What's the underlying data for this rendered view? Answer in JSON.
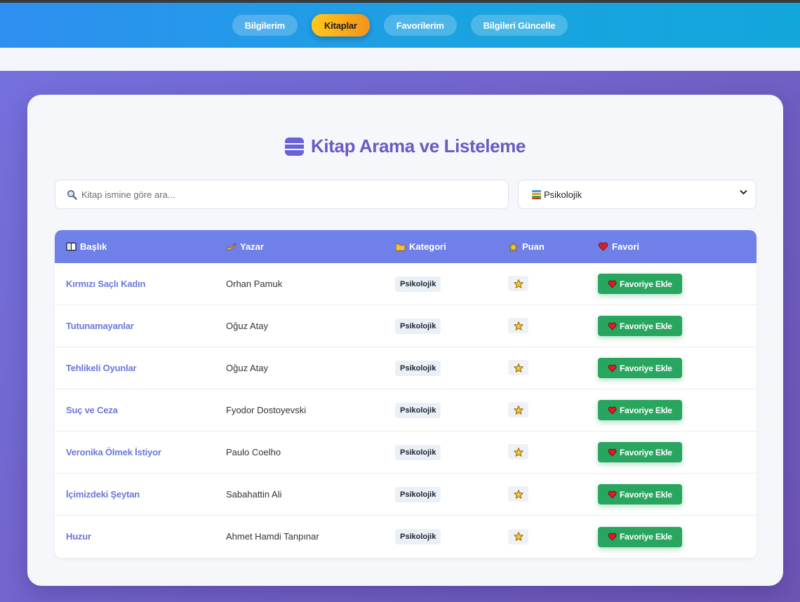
{
  "navbar": {
    "items": [
      {
        "label": "Bilgilerim",
        "active": false
      },
      {
        "label": "Kitaplar",
        "active": true
      },
      {
        "label": "Favorilerim",
        "active": false
      },
      {
        "label": "Bilgileri Güncelle",
        "active": false
      }
    ]
  },
  "page": {
    "title": "Kitap Arama ve Listeleme",
    "title_icon": "books-icon"
  },
  "search": {
    "placeholder": "Kitap ismine göre ara...",
    "value": "",
    "icon": "magnifier-icon"
  },
  "category_select": {
    "selected": "Psikolojik",
    "icon": "books-stack-icon"
  },
  "table": {
    "headers": {
      "title": "Başlık",
      "author": "Yazar",
      "category": "Kategori",
      "rating": "Puan",
      "favorite": "Favori"
    },
    "header_icons": {
      "title": "open-book-icon",
      "author": "writing-hand-icon",
      "category": "folder-icon",
      "rating": "star-icon",
      "favorite": "heart-icon"
    },
    "rows": [
      {
        "title": "Kırmızı Saçlı Kadın",
        "author": "Orhan Pamuk",
        "category": "Psikolojik",
        "button": "Favoriye Ekle"
      },
      {
        "title": "Tutunamayanlar",
        "author": "Oğuz Atay",
        "category": "Psikolojik",
        "button": "Favoriye Ekle"
      },
      {
        "title": "Tehlikeli Oyunlar",
        "author": "Oğuz Atay",
        "category": "Psikolojik",
        "button": "Favoriye Ekle"
      },
      {
        "title": "Suç ve Ceza",
        "author": "Fyodor Dostoyevski",
        "category": "Psikolojik",
        "button": "Favoriye Ekle"
      },
      {
        "title": "Veronika Ölmek İstiyor",
        "author": "Paulo Coelho",
        "category": "Psikolojik",
        "button": "Favoriye Ekle"
      },
      {
        "title": "İçimizdeki Şeytan",
        "author": "Sabahattin Ali",
        "category": "Psikolojik",
        "button": "Favoriye Ekle"
      },
      {
        "title": "Huzur",
        "author": "Ahmet Hamdi Tanpınar",
        "category": "Psikolojik",
        "button": "Favoriye Ekle"
      }
    ]
  },
  "colors": {
    "accent": "#6a5ac2",
    "table_header": "#6f80e8",
    "favorite_button": "#28a55f",
    "active_nav": "#f3a81c"
  }
}
